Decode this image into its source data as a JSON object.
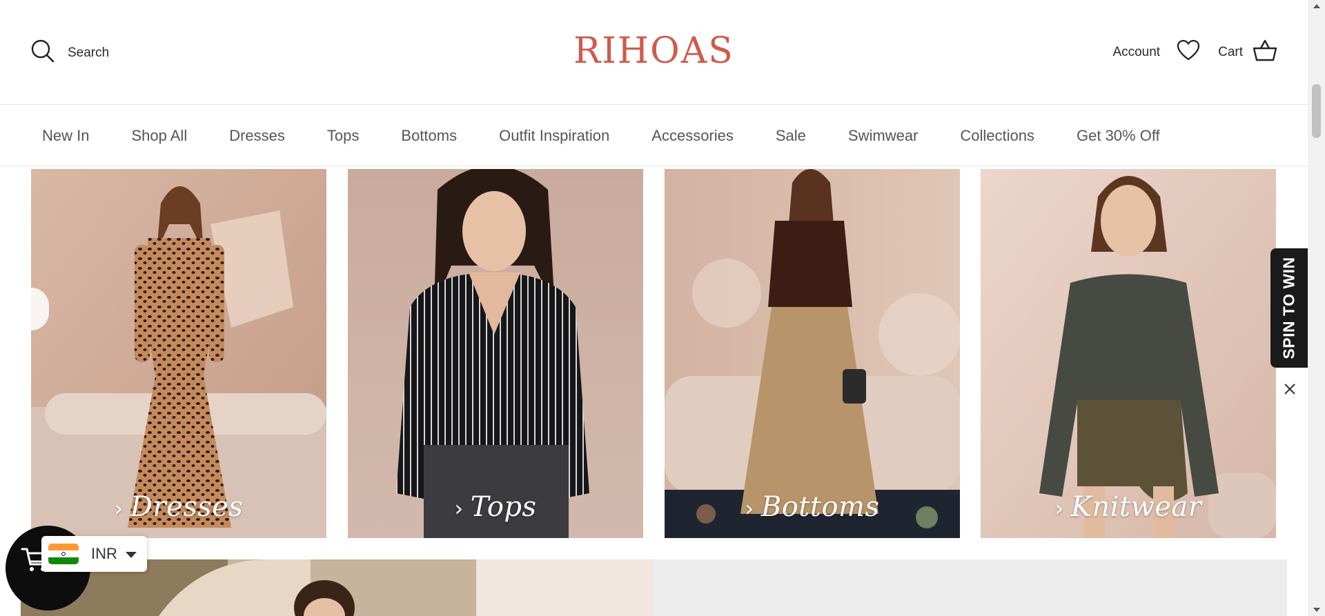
{
  "header": {
    "search_label": "Search",
    "logo": "RIHOAS",
    "account_label": "Account",
    "cart_label": "Cart"
  },
  "nav": {
    "items": [
      {
        "label": "New In"
      },
      {
        "label": "Shop All"
      },
      {
        "label": "Dresses"
      },
      {
        "label": "Tops"
      },
      {
        "label": "Bottoms"
      },
      {
        "label": "Outfit Inspiration"
      },
      {
        "label": "Accessories"
      },
      {
        "label": "Sale"
      },
      {
        "label": "Swimwear"
      },
      {
        "label": "Collections"
      },
      {
        "label": "Get 30% Off"
      }
    ]
  },
  "categories": [
    {
      "label": "Dresses"
    },
    {
      "label": "Tops"
    },
    {
      "label": "Bottoms"
    },
    {
      "label": "Knitwear"
    }
  ],
  "promo": {
    "spin_label": "SPIN TO WIN"
  },
  "currency": {
    "code": "INR",
    "flag_colors": [
      "#ff9933",
      "#ffffff",
      "#138808"
    ]
  },
  "colors": {
    "brand": "#cf5b4b",
    "promo_bg": "#1a1a1a"
  }
}
